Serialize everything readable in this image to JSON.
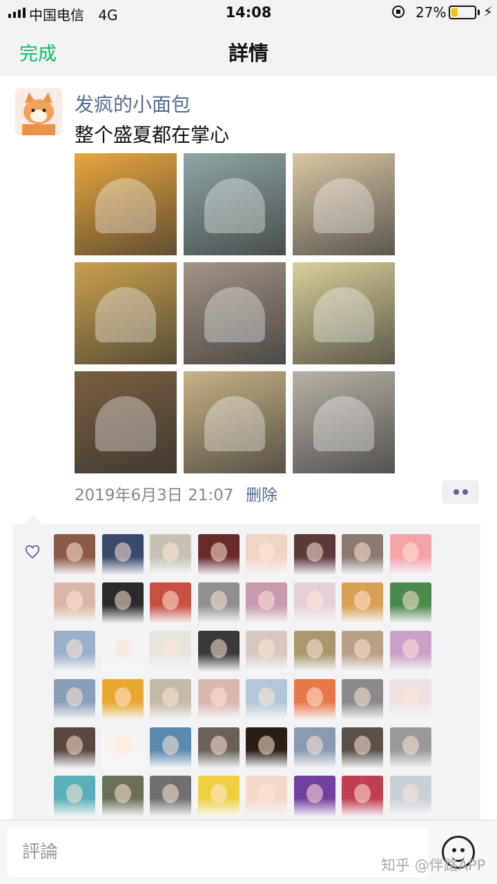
{
  "status_bar": {
    "carrier": "中国电信",
    "network": "4G",
    "time": "14:08",
    "battery": "27%",
    "battery_level": 0.27
  },
  "nav": {
    "done": "完成",
    "title": "詳情"
  },
  "post": {
    "username": "发疯的小面包",
    "text": "整个盛夏都在掌心",
    "time": "2019年6月3日 21:07",
    "delete": "删除",
    "photos": [
      {
        "icon": "mango-dessert-photo",
        "bg": "#e9a73d"
      },
      {
        "icon": "iced-water-glass-photo",
        "bg": "#8fa6a6"
      },
      {
        "icon": "mango-dessert-cup-photo",
        "bg": "#d9c6a4"
      },
      {
        "icon": "iced-tea-glass-photo",
        "bg": "#c9a14e"
      },
      {
        "icon": "nitro-coffee-photo",
        "bg": "#a39385"
      },
      {
        "icon": "oreo-cake-photo",
        "bg": "#d9cf98"
      },
      {
        "icon": "shop-front-photo",
        "bg": "#7a5f40"
      },
      {
        "icon": "pancake-plate-photo",
        "bg": "#c7b286"
      },
      {
        "icon": "ice-cream-cone-photo",
        "bg": "#b9b2a6"
      }
    ]
  },
  "likes": {
    "avatars": [
      "#8c5a48",
      "#3a4a6c",
      "#c8c1b6",
      "#6a2a2a",
      "#f0d4c4",
      "#5b3a3a",
      "#8a7a70",
      "#f4a3a8",
      "#d9b8a8",
      "#2a2a2a",
      "#c85040",
      "#909090",
      "#c89ab0",
      "#e6d0d8",
      "#d8a050",
      "#4a8a4a",
      "#9ab0c8",
      "#f4f4f4",
      "#e8e4dc",
      "#3a3a3a",
      "#d8c8c0",
      "#a89870",
      "#b8a088",
      "#c8a0c8",
      "#8aa0b8",
      "#e8a830",
      "#c4b8a8",
      "#d8b8b0",
      "#b0c8d8",
      "#e87848",
      "#8a8a8a",
      "#f0e0e0",
      "#5a4840",
      "#f8f4f0",
      "#5a8ab0",
      "#6a6058",
      "#2a1e14",
      "#8a9ab0",
      "#5a5048",
      "#9a9a9a",
      "#5ab0b8",
      "#6a7058",
      "#707070",
      "#f0d040",
      "#f4d8c8",
      "#7040a0",
      "#c04050",
      "#c8d0d8"
    ]
  },
  "comment": {
    "placeholder": "評論"
  },
  "watermark": "知乎 @伴路APP"
}
